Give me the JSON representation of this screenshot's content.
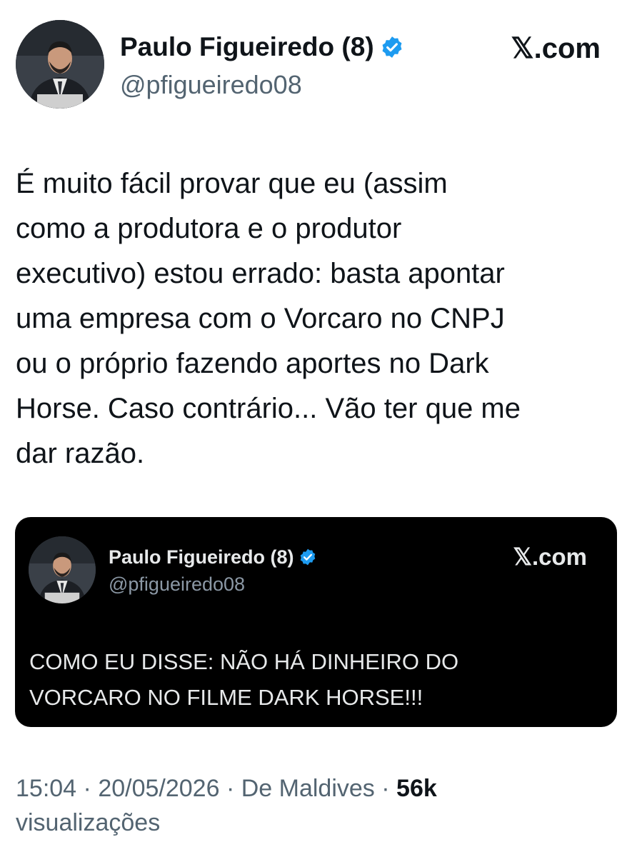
{
  "author": {
    "name": "Paulo Figueiredo (8)",
    "handle": "@pfigueiredo08",
    "verified": true,
    "badge_color": "#1d9bf0"
  },
  "brand": "𝕏.com",
  "tweet": {
    "lines": [
      "É muito fácil provar que eu (assim",
      "como a produtora e o produtor",
      "executivo) estou errado: basta apontar",
      "uma empresa com o Vorcaro no CNPJ",
      "ou o próprio fazendo aportes no Dark",
      "Horse. Caso contrário... Vão ter que me",
      "dar razão."
    ]
  },
  "quote": {
    "name": "Paulo Figueiredo (8)",
    "handle": "@pfigueiredo08",
    "brand": "𝕏.com",
    "lines": [
      "COMO EU DISSE: NÃO HÁ DINHEIRO DO",
      "VORCARO NO FILME DARK HORSE!!!"
    ]
  },
  "meta": {
    "time": "15:04",
    "date": "20/05/2026",
    "location": "De Maldives",
    "views_count": "56k",
    "views_label": "visualizações"
  },
  "colors": {
    "text": "#0f1419",
    "secondary": "#536471",
    "quote_bg": "#000000"
  }
}
